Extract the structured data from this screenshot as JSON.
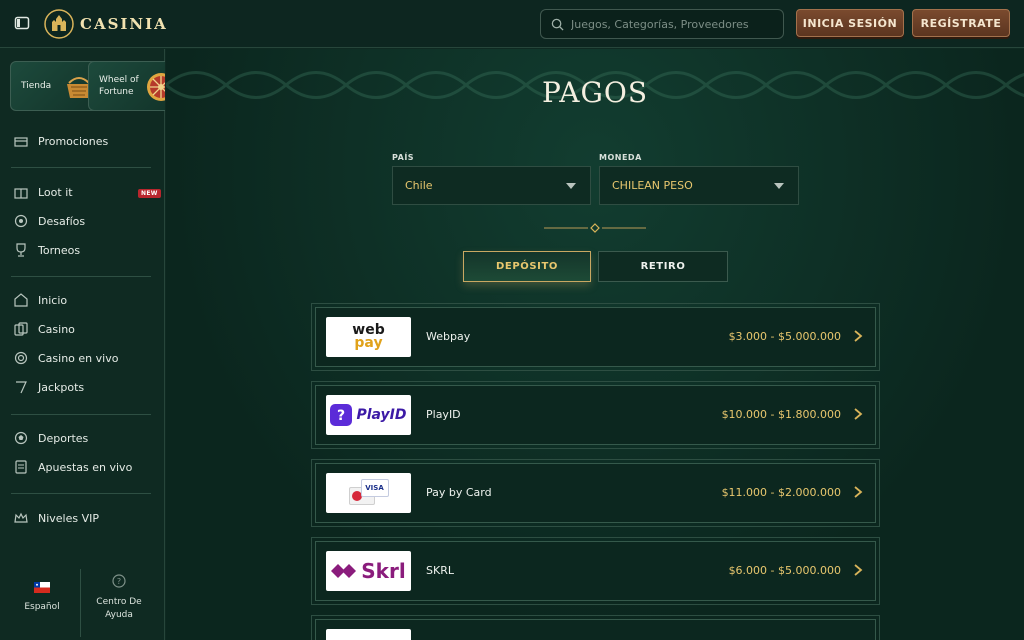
{
  "header": {
    "logo_text": "CASINIA",
    "search_placeholder": "Juegos, Categorías, Proveedores",
    "login_label": "INICIA SESIÓN",
    "register_label": "REGÍSTRATE"
  },
  "sidebar": {
    "tiles": [
      {
        "label": "Tienda",
        "icon": "basket-icon"
      },
      {
        "label": "Wheel of Fortune",
        "icon": "wheel-icon"
      }
    ],
    "items": [
      {
        "label": "Promociones",
        "icon": "gift-icon"
      },
      {
        "label": "Loot it",
        "icon": "chest-icon",
        "badge": "NEW"
      },
      {
        "label": "Desafíos",
        "icon": "target-icon"
      },
      {
        "label": "Torneos",
        "icon": "trophy-icon"
      },
      {
        "label": "Inicio",
        "icon": "home-icon"
      },
      {
        "label": "Casino",
        "icon": "cards-icon"
      },
      {
        "label": "Casino en vivo",
        "icon": "chip-icon"
      },
      {
        "label": "Jackpots",
        "icon": "slot-icon"
      },
      {
        "label": "Deportes",
        "icon": "ball-icon"
      },
      {
        "label": "Apuestas en vivo",
        "icon": "ticket-icon"
      },
      {
        "label": "Niveles VIP",
        "icon": "crown-icon"
      }
    ],
    "footer": {
      "language": "Español",
      "help": "Centro De Ayuda"
    }
  },
  "main": {
    "title": "PAGOS",
    "country_label": "PAÍS",
    "country_value": "Chile",
    "currency_label": "MONEDA",
    "currency_value": "CHILEAN PESO",
    "tabs": [
      {
        "label": "DEPÓSITO",
        "active": true
      },
      {
        "label": "RETIRO",
        "active": false
      }
    ],
    "methods": [
      {
        "name": "Webpay",
        "range": "$3.000 - $5.000.000"
      },
      {
        "name": "PlayID",
        "range": "$10.000 - $1.800.000"
      },
      {
        "name": "Pay by Card",
        "range": "$11.000 - $2.000.000"
      },
      {
        "name": "SKRL",
        "range": "$6.000 - $5.000.000"
      }
    ],
    "method_logos": {
      "webpay_top": "web",
      "webpay_bottom": "pay",
      "playid": "PlayID",
      "card": "VISA",
      "skrl": "Skrl"
    }
  },
  "colors": {
    "accent_gold": "#e8c76e",
    "background": "#0f2a22",
    "button_brown": "#6b3f27"
  }
}
